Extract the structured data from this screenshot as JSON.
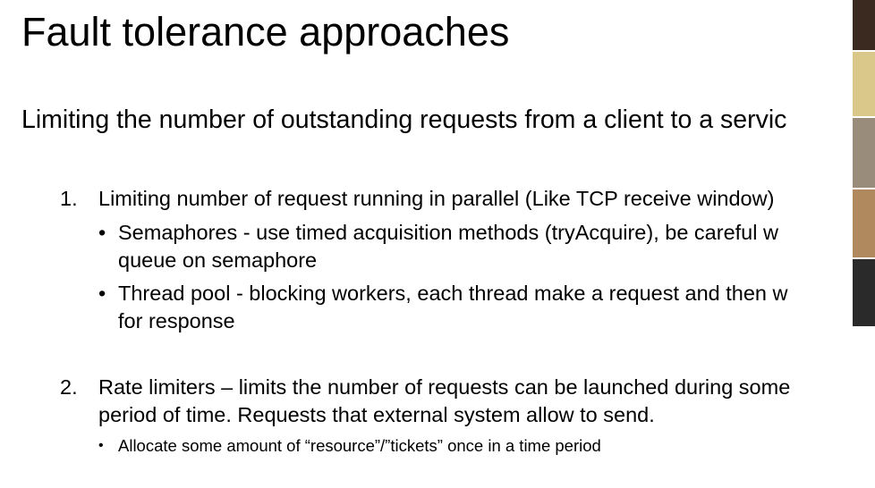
{
  "slide": {
    "title": "Fault tolerance approaches",
    "subtitle": "Limiting the number of outstanding requests from a client to a servic",
    "items": [
      {
        "number": "1.",
        "text": "Limiting number of request running in parallel (Like TCP receive window)",
        "bullets": [
          {
            "lines": [
              "Semaphores  - use timed acquisition methods (tryAcquire), be careful w",
              "queue on semaphore"
            ]
          },
          {
            "lines": [
              "Thread pool - blocking workers, each thread make a request and then w",
              "for response"
            ]
          }
        ]
      },
      {
        "number": "2.",
        "lines": [
          "Rate limiters – limits the number of requests can be launched during some",
          "period of time. Requests that external system allow to send."
        ],
        "bullets": [
          {
            "lines": [
              "Allocate some amount of “resource”/”tickets” once in a time period"
            ]
          }
        ]
      }
    ],
    "bullet_glyph": "•"
  },
  "video_tiles": [
    {
      "name": "participant-1",
      "color": "#3a2a20"
    },
    {
      "name": "participant-2",
      "color": "#d9c88a"
    },
    {
      "name": "participant-3",
      "color": "#9a8c7a"
    },
    {
      "name": "participant-4",
      "color": "#b08a5e"
    },
    {
      "name": "participant-5",
      "color": "#2a2a2a"
    }
  ]
}
